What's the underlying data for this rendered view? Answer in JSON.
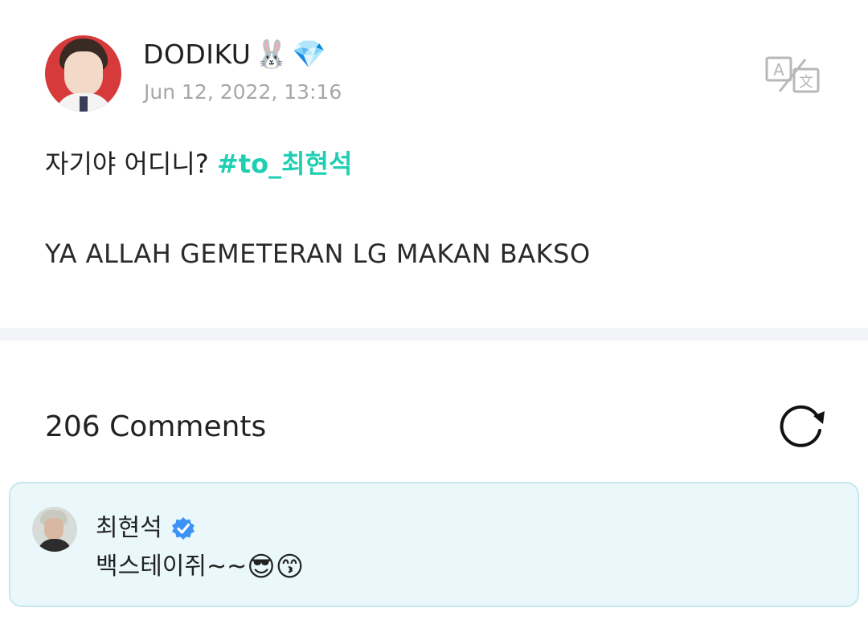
{
  "post": {
    "author": {
      "name": "DODIKU",
      "badges": [
        "🐰",
        "💎"
      ]
    },
    "date": "Jun 12, 2022, 13:16",
    "line1_text": "자기야 어디니? ",
    "line1_hashtag": "#to_최현석",
    "line2_text": "YA ALLAH GEMETERAN LG MAKAN BAKSO",
    "translate_icon": "translate-icon"
  },
  "comments": {
    "count_label": "206 Comments",
    "refresh_icon": "refresh-icon",
    "items": [
      {
        "author": "최현석",
        "verified": true,
        "text": "백스테이쥐~~",
        "emojis": [
          "😎",
          "😙"
        ]
      }
    ]
  },
  "colors": {
    "hashtag": "#1fcfb3",
    "date": "#a7a7a7",
    "divider": "#f3f4f7",
    "comment_card_bg": "#eaf8fc",
    "comment_card_border": "#c7e7ef",
    "verified": "#3d93f5"
  }
}
